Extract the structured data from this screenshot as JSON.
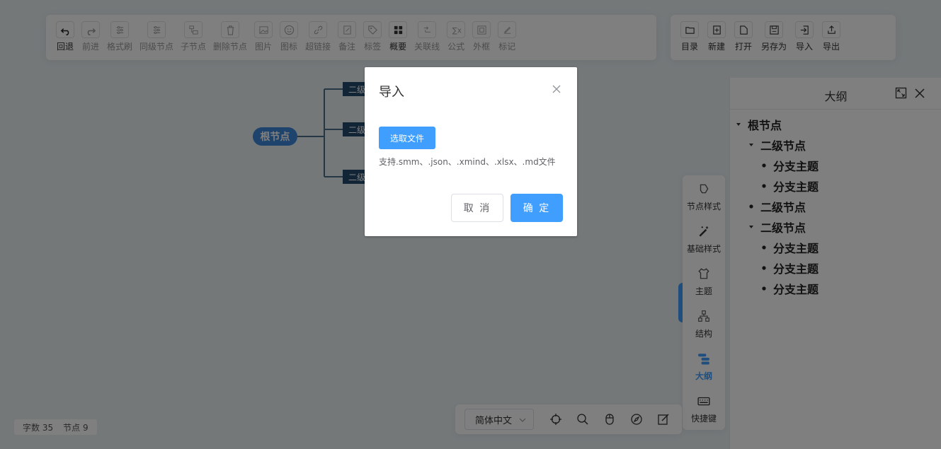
{
  "toolbar_main": [
    {
      "label": "回退",
      "icon": "undo-icon",
      "enabled": true
    },
    {
      "label": "前进",
      "icon": "redo-icon",
      "enabled": false
    },
    {
      "label": "格式刷",
      "icon": "format-brush-icon",
      "enabled": false
    },
    {
      "label": "同级节点",
      "icon": "sibling-node-icon",
      "enabled": false
    },
    {
      "label": "子节点",
      "icon": "child-node-icon",
      "enabled": false
    },
    {
      "label": "删除节点",
      "icon": "delete-icon",
      "enabled": false
    },
    {
      "label": "图片",
      "icon": "image-icon",
      "enabled": false
    },
    {
      "label": "图标",
      "icon": "smile-icon",
      "enabled": false
    },
    {
      "label": "超链接",
      "icon": "link-icon",
      "enabled": false
    },
    {
      "label": "备注",
      "icon": "note-icon",
      "enabled": false
    },
    {
      "label": "标签",
      "icon": "tag-icon",
      "enabled": false
    },
    {
      "label": "概要",
      "icon": "summary-icon",
      "enabled": true
    },
    {
      "label": "关联线",
      "icon": "association-line-icon",
      "enabled": false
    },
    {
      "label": "公式",
      "icon": "formula-icon",
      "enabled": false
    },
    {
      "label": "外框",
      "icon": "frame-icon",
      "enabled": false
    },
    {
      "label": "标记",
      "icon": "mark-icon",
      "enabled": false
    }
  ],
  "toolbar_file": [
    {
      "label": "目录",
      "icon": "folder-icon"
    },
    {
      "label": "新建",
      "icon": "new-file-icon"
    },
    {
      "label": "打开",
      "icon": "open-file-icon"
    },
    {
      "label": "另存为",
      "icon": "save-as-icon"
    },
    {
      "label": "导入",
      "icon": "import-icon"
    },
    {
      "label": "导出",
      "icon": "export-icon"
    }
  ],
  "mindmap": {
    "root": "根节点",
    "secondary": [
      "二级",
      "二级",
      "二级"
    ]
  },
  "outline": {
    "title": "大纲",
    "items": [
      {
        "text": "根节点",
        "level": 0,
        "mark": "caret"
      },
      {
        "text": "二级节点",
        "level": 1,
        "mark": "caret"
      },
      {
        "text": "分支主题",
        "level": 2,
        "mark": "dot"
      },
      {
        "text": "分支主题",
        "level": 2,
        "mark": "dot"
      },
      {
        "text": "二级节点",
        "level": 1,
        "mark": "dot"
      },
      {
        "text": "二级节点",
        "level": 1,
        "mark": "caret"
      },
      {
        "text": "分支主题",
        "level": 2,
        "mark": "dot"
      },
      {
        "text": "分支主题",
        "level": 2,
        "mark": "dot"
      },
      {
        "text": "分支主题",
        "level": 2,
        "mark": "dot"
      }
    ]
  },
  "sidenav": [
    {
      "label": "节点样式",
      "icon": "node-style-icon",
      "active": false
    },
    {
      "label": "基础样式",
      "icon": "magic-wand-icon",
      "active": false
    },
    {
      "label": "主题",
      "icon": "shirt-icon",
      "active": false
    },
    {
      "label": "结构",
      "icon": "structure-icon",
      "active": false
    },
    {
      "label": "大纲",
      "icon": "outline-icon",
      "active": true
    },
    {
      "label": "快捷键",
      "icon": "keyboard-icon",
      "active": false
    }
  ],
  "bottombar": {
    "language": "简体中文"
  },
  "stats": {
    "words_label": "字数",
    "words": "35",
    "nodes_label": "节点",
    "nodes": "9"
  },
  "dialog": {
    "title": "导入",
    "pick_button": "选取文件",
    "tip": "支持.smm、.json、.xmind、.xlsx、.md文件",
    "cancel": "取 消",
    "confirm": "确 定"
  },
  "colors": {
    "accent": "#409eff",
    "root_node": "#3d86d8",
    "secondary_node": "#254b6c"
  }
}
